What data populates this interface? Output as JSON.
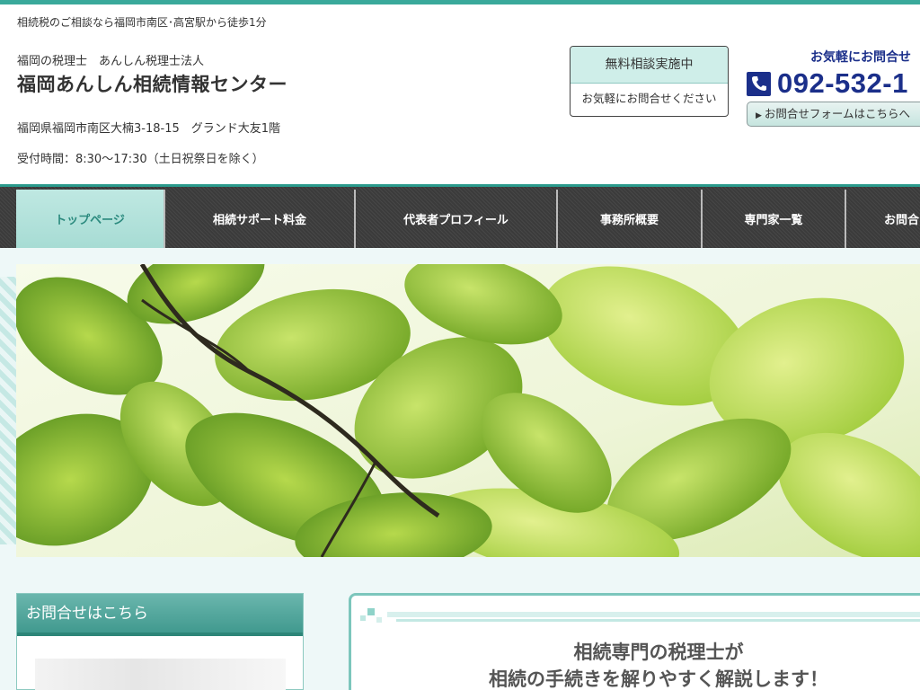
{
  "header": {
    "tagline": "相続税のご相談なら福岡市南区･高宮駅から徒歩1分",
    "subtitle": "福岡の税理士　あんしん税理士法人",
    "title": "福岡あんしん相続情報センター",
    "address": "福岡県福岡市南区大楠3-18-15　グランド大友1階",
    "hours": "受付時間：8:30～17:30（土日祝祭日を除く）"
  },
  "consult": {
    "heading": "無料相談実施中",
    "sub": "お気軽にお問合せください"
  },
  "contact": {
    "lead": "お気軽にお問合せ",
    "phone": "092-532-1",
    "phone_icon": "phone-icon",
    "form_link": "お問合せフォームはこちらへ"
  },
  "nav": {
    "items": [
      {
        "label": "トップページ"
      },
      {
        "label": "相続サポート料金"
      },
      {
        "label": "代表者プロフィール"
      },
      {
        "label": "事務所概要"
      },
      {
        "label": "専門家一覧"
      },
      {
        "label": "お問合"
      }
    ]
  },
  "sidebar": {
    "heading": "お問合せはこちら"
  },
  "main": {
    "heading_line1": "相続専門の税理士が",
    "heading_line2": "相続の手続きを解りやすく解説します！"
  },
  "colors": {
    "accent": "#3aa99b",
    "brand": "#1b2f8a",
    "nav_bg": "#3b3b3b"
  }
}
